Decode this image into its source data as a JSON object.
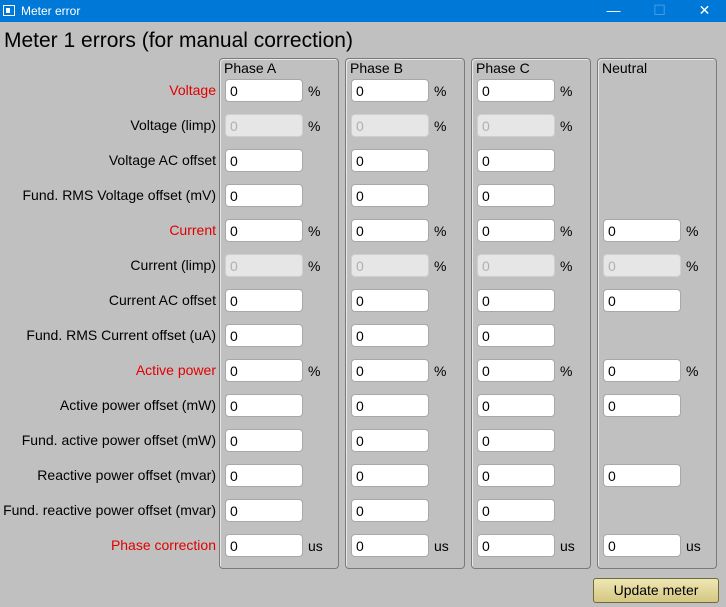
{
  "window": {
    "title": "Meter error",
    "minimize_glyph": "—",
    "maximize_glyph": "☐",
    "close_glyph": "✕"
  },
  "page_title": "Meter 1 errors (for manual correction)",
  "columns": [
    "Phase A",
    "Phase B",
    "Phase C",
    "Neutral"
  ],
  "rows": [
    {
      "label": "Voltage",
      "highlight": true,
      "unit": "%",
      "values": [
        "0",
        "0",
        "0",
        null
      ],
      "disabled": false
    },
    {
      "label": "Voltage (limp)",
      "highlight": false,
      "unit": "%",
      "values": [
        "0",
        "0",
        "0",
        null
      ],
      "disabled": true
    },
    {
      "label": "Voltage AC offset",
      "highlight": false,
      "unit": "",
      "values": [
        "0",
        "0",
        "0",
        null
      ],
      "disabled": false
    },
    {
      "label": "Fund. RMS Voltage offset (mV)",
      "highlight": false,
      "unit": "",
      "values": [
        "0",
        "0",
        "0",
        null
      ],
      "disabled": false
    },
    {
      "label": "Current",
      "highlight": true,
      "unit": "%",
      "values": [
        "0",
        "0",
        "0",
        "0"
      ],
      "disabled": false
    },
    {
      "label": "Current (limp)",
      "highlight": false,
      "unit": "%",
      "values": [
        "0",
        "0",
        "0",
        "0"
      ],
      "disabled": true
    },
    {
      "label": "Current AC offset",
      "highlight": false,
      "unit": "",
      "values": [
        "0",
        "0",
        "0",
        "0"
      ],
      "disabled": false
    },
    {
      "label": "Fund. RMS Current offset (uA)",
      "highlight": false,
      "unit": "",
      "values": [
        "0",
        "0",
        "0",
        null
      ],
      "disabled": false
    },
    {
      "label": "Active power",
      "highlight": true,
      "unit": "%",
      "values": [
        "0",
        "0",
        "0",
        "0"
      ],
      "disabled": false
    },
    {
      "label": "Active power offset (mW)",
      "highlight": false,
      "unit": "",
      "values": [
        "0",
        "0",
        "0",
        "0"
      ],
      "disabled": false
    },
    {
      "label": "Fund. active power offset (mW)",
      "highlight": false,
      "unit": "",
      "values": [
        "0",
        "0",
        "0",
        null
      ],
      "disabled": false
    },
    {
      "label": "Reactive power offset (mvar)",
      "highlight": false,
      "unit": "",
      "values": [
        "0",
        "0",
        "0",
        "0"
      ],
      "disabled": false
    },
    {
      "label": "Fund. reactive power offset (mvar)",
      "highlight": false,
      "unit": "",
      "values": [
        "0",
        "0",
        "0",
        null
      ],
      "disabled": false
    },
    {
      "label": "Phase correction",
      "highlight": true,
      "unit": "us",
      "values": [
        "0",
        "0",
        "0",
        "0"
      ],
      "disabled": false
    }
  ],
  "update_button": "Update meter",
  "colors": {
    "highlight_label": "#e00000",
    "titlebar": "#0078d7",
    "background": "#c0c0c0"
  }
}
